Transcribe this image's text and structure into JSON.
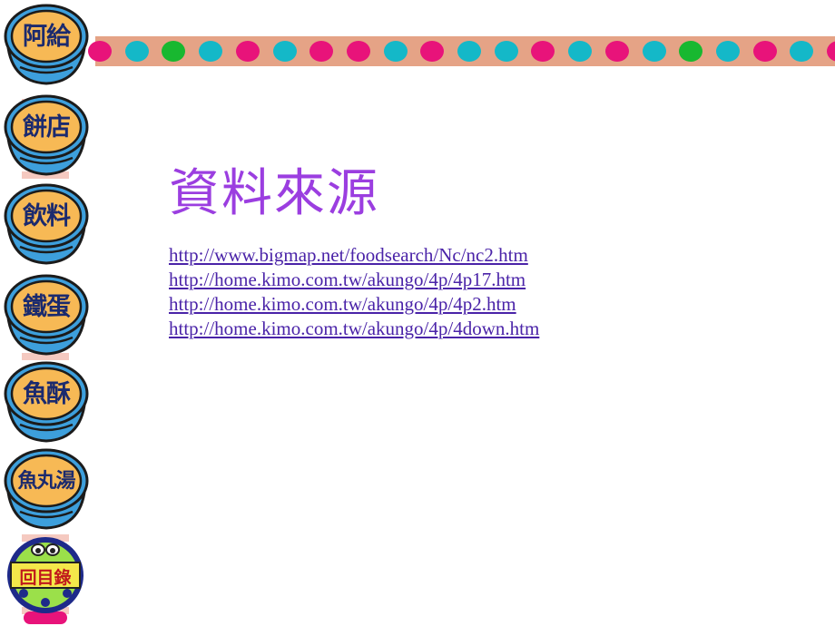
{
  "nav": {
    "items": [
      {
        "label": "阿給"
      },
      {
        "label": "餅店"
      },
      {
        "label": "飲料"
      },
      {
        "label": "鐵蛋"
      },
      {
        "label": "魚酥"
      },
      {
        "label": "魚丸湯"
      }
    ],
    "toc_label": "回目錄"
  },
  "ribbon": {
    "dot_colors": [
      "#e8137a",
      "#14b8c8",
      "#18b830",
      "#14b8c8",
      "#e8137a",
      "#14b8c8",
      "#e8137a",
      "#e8137a",
      "#14b8c8",
      "#e8137a",
      "#14b8c8",
      "#14b8c8",
      "#e8137a",
      "#14b8c8",
      "#e8137a",
      "#14b8c8",
      "#18b830",
      "#14b8c8",
      "#e8137a",
      "#14b8c8",
      "#e8137a"
    ]
  },
  "main": {
    "title": "資料來源",
    "links": [
      {
        "text": "http://www.bigmap.net/foodsearch/Nc/nc2.htm"
      },
      {
        "text": "http://home.kimo.com.tw/akungo/4p/4p17.htm"
      },
      {
        "text": "http://home.kimo.com.tw/akungo/4p/4p2.htm"
      },
      {
        "text": "http://home.kimo.com.tw/akungo/4p/4down.htm"
      }
    ]
  },
  "colors": {
    "ribbon": "#e5a386",
    "title": "#9b3ee0",
    "link": "#4a23a8",
    "bowl_fill": "#f7b955",
    "bowl_body": "#3d9fdc",
    "outline": "#1b1b1b"
  }
}
